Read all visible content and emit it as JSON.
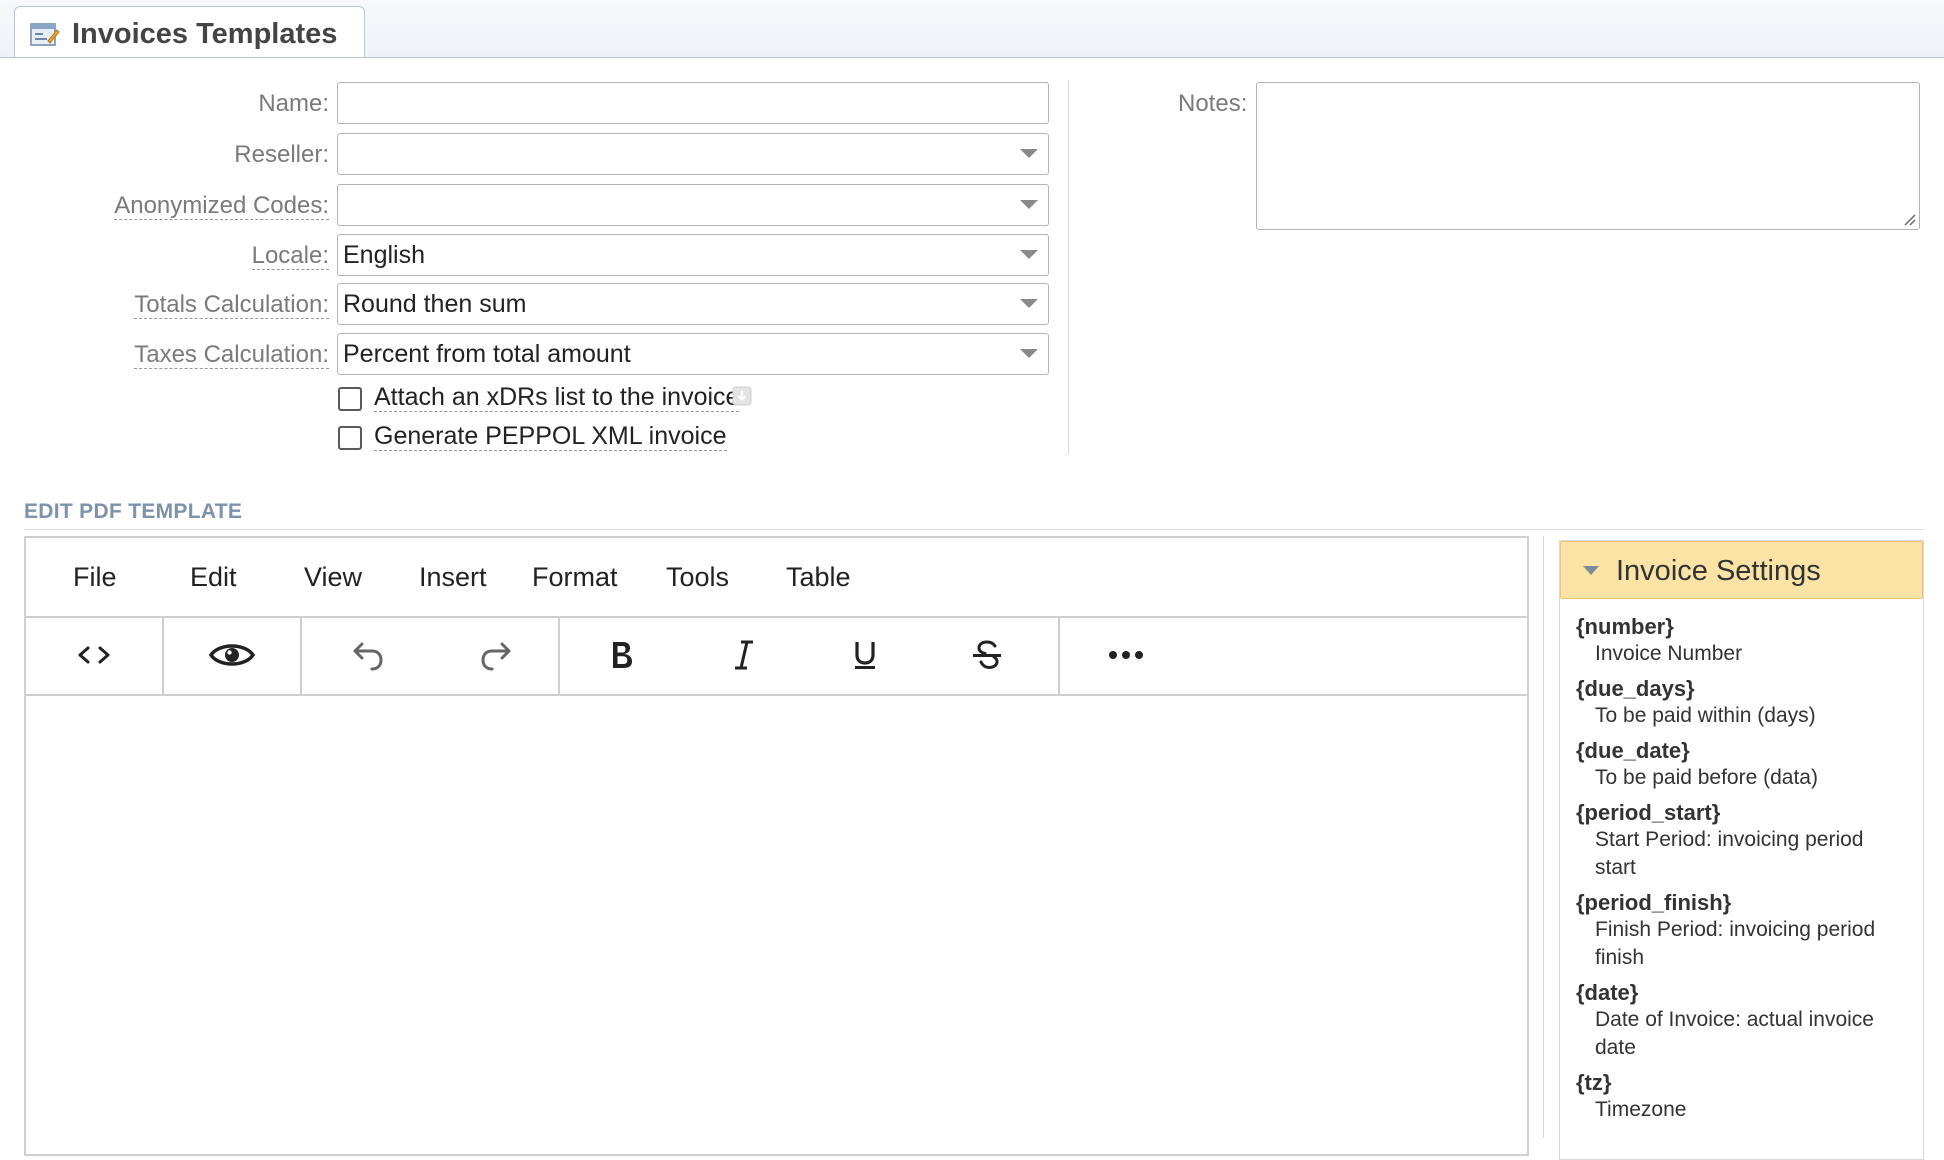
{
  "header": {
    "tab_title": "Invoices Templates"
  },
  "form": {
    "name": {
      "label": "Name:",
      "value": ""
    },
    "reseller": {
      "label": "Reseller:",
      "value": ""
    },
    "anonymized_codes": {
      "label": "Anonymized Codes:",
      "value": ""
    },
    "locale": {
      "label": "Locale:",
      "value": "English"
    },
    "totals_calculation": {
      "label": "Totals Calculation:",
      "value": "Round then sum"
    },
    "taxes_calculation": {
      "label": "Taxes Calculation:",
      "value": "Percent from total amount"
    },
    "attach_xdrs": {
      "label": "Attach an xDRs list to the invoice",
      "checked": false
    },
    "generate_peppol": {
      "label": "Generate PEPPOL XML invoice",
      "checked": false
    },
    "notes": {
      "label": "Notes:",
      "value": ""
    }
  },
  "section": {
    "title": "EDIT PDF TEMPLATE"
  },
  "editor": {
    "menu": [
      "File",
      "Edit",
      "View",
      "Insert",
      "Format",
      "Tools",
      "Table"
    ],
    "toolbar": [
      "source-code",
      "preview",
      "undo",
      "redo",
      "bold",
      "italic",
      "underline",
      "strikethrough",
      "more"
    ]
  },
  "settings": {
    "title": "Invoice Settings",
    "items": [
      {
        "key": "{number}",
        "desc": "Invoice Number"
      },
      {
        "key": "{due_days}",
        "desc": "To be paid within (days)"
      },
      {
        "key": "{due_date}",
        "desc": "To be paid before (data)"
      },
      {
        "key": "{period_start}",
        "desc": "Start Period: invoicing period start"
      },
      {
        "key": "{period_finish}",
        "desc": "Finish Period: invoicing period finish"
      },
      {
        "key": "{date}",
        "desc": "Date of Invoice: actual invoice date"
      },
      {
        "key": "{tz}",
        "desc": "Timezone"
      }
    ]
  },
  "colors": {
    "accent_header": "#fbe3a6",
    "section_title": "#7d92ab"
  }
}
